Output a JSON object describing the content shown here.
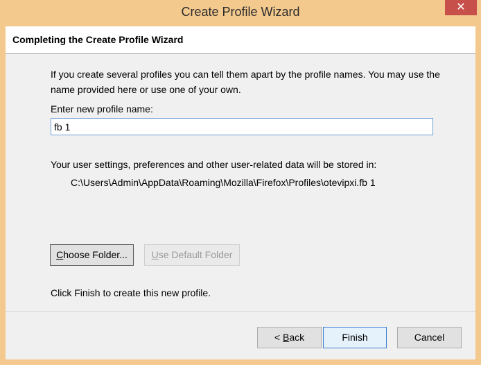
{
  "window": {
    "title": "Create Profile Wizard",
    "close_glyph": "✕"
  },
  "header": {
    "title": "Completing the Create Profile Wizard"
  },
  "content": {
    "intro_text": "If you create several profiles you can tell them apart by the profile names. You may use the name provided here or use one of your own.",
    "name_label": "Enter new profile name:",
    "name_value": "fb 1",
    "storage_text": "Your user settings, preferences and other user-related data will be stored in:",
    "storage_path": "C:\\Users\\Admin\\AppData\\Roaming\\Mozilla\\Firefox\\Profiles\\otevipxi.fb 1",
    "choose_folder_accel": "C",
    "choose_folder_rest": "hoose Folder...",
    "default_folder_accel": "U",
    "default_folder_rest": "se Default Folder",
    "finish_hint": "Click Finish to create this new profile."
  },
  "footer": {
    "back_prefix": "< ",
    "back_accel": "B",
    "back_rest": "ack",
    "finish_label": "Finish",
    "cancel_label": "Cancel"
  }
}
